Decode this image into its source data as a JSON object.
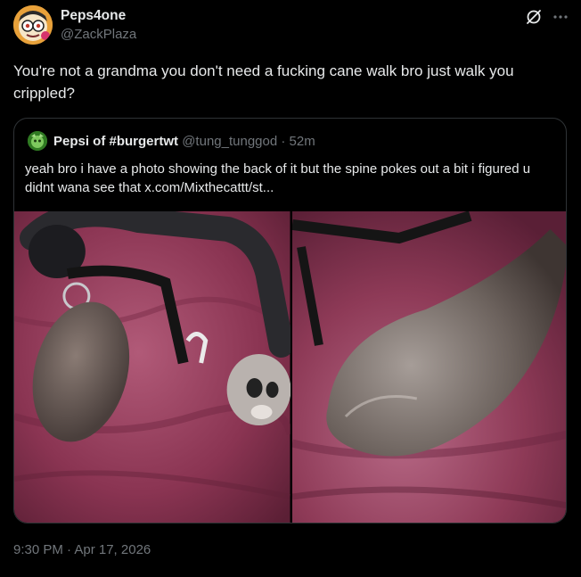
{
  "author": {
    "name": "Peps4one",
    "handle": "@ZackPlaza"
  },
  "tweet": {
    "text": "You're not a grandma you don't need a fucking cane walk bro just walk you crippled?",
    "timestamp": "9:30 PM · Apr 17, 2026"
  },
  "quoted": {
    "name": "Pepsi of #burgertwt",
    "handle": "@tung_tunggod",
    "separator": "·",
    "time": "52m",
    "text": "yeah bro     i have a photo showing the back of it but the spine pokes out a bit i figured u didnt wana see that  x.com/Mixthecattt/st...",
    "media_count": 2
  },
  "icons": {
    "grok": "grok-icon",
    "more": "more-icon"
  },
  "colors": {
    "background": "#000000",
    "primary_text": "#e7e9ea",
    "secondary_text": "#71767b",
    "border": "#2f3336"
  }
}
